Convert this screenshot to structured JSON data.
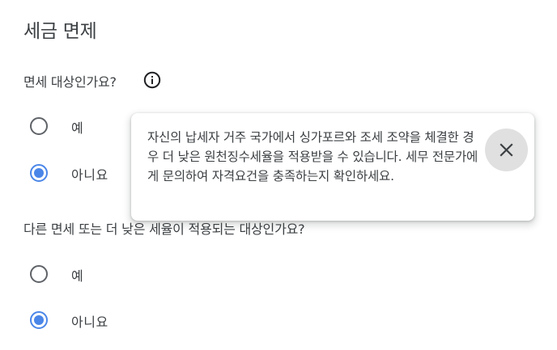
{
  "section": {
    "title": "세금 면제"
  },
  "question1": {
    "text": "면세 대상인가요?",
    "info_icon": "info-icon",
    "options": [
      {
        "label": "예",
        "checked": false
      },
      {
        "label": "아니요",
        "checked": true
      }
    ]
  },
  "tooltip": {
    "text": "자신의 납세자 거주 국가에서 싱가포르와 조세 조약을 체결한 경우 더 낮은 원천징수세율을 적용받을 수 있습니다. 세무 전문가에게 문의하여 자격요건을 충족하는지 확인하세요.",
    "close_icon": "close-icon"
  },
  "question2": {
    "text": "다른 면세 또는 더 낮은 세율이 적용되는 대상인가요?",
    "options": [
      {
        "label": "예",
        "checked": false
      },
      {
        "label": "아니요",
        "checked": true
      }
    ]
  },
  "colors": {
    "accent": "#4a86e8",
    "text": "#3c4043",
    "close_bg": "#e0e0e0"
  }
}
